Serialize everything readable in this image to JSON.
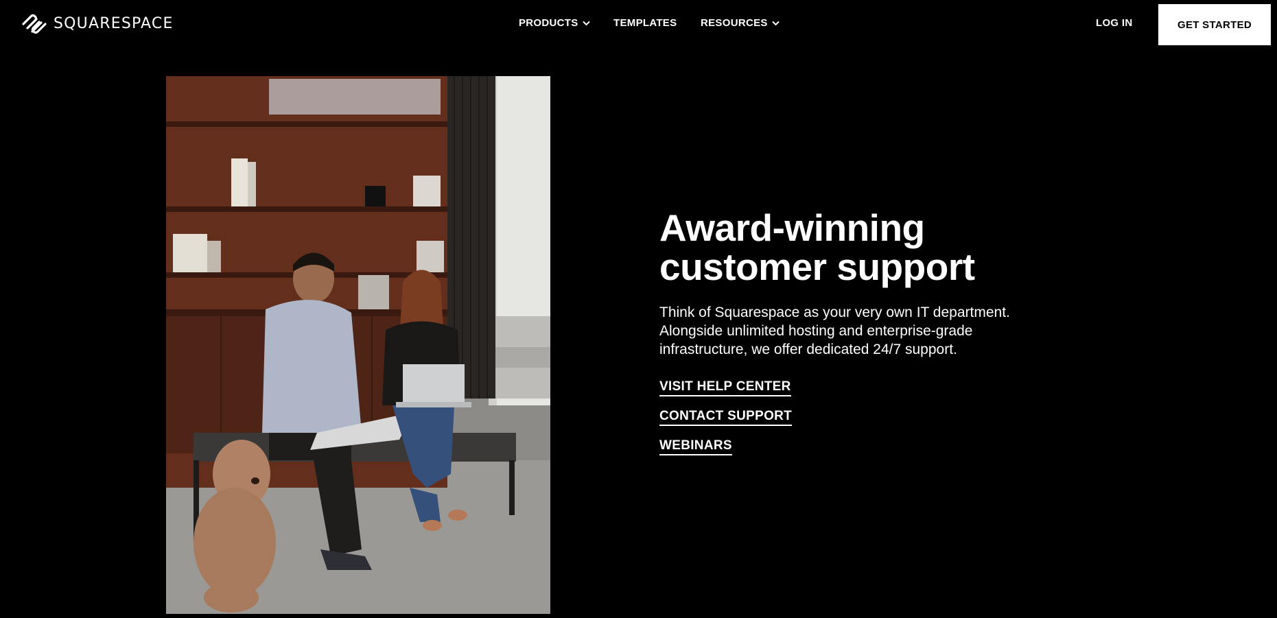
{
  "brand": {
    "name": "SQUARESPACE",
    "logo_icon": "squarespace-logo-icon"
  },
  "nav": {
    "products": "PRODUCTS",
    "templates": "TEMPLATES",
    "resources": "RESOURCES",
    "dropdown_icon": "chevron-down-icon"
  },
  "header_actions": {
    "login": "LOG IN",
    "get_started": "GET STARTED"
  },
  "hero": {
    "headline_line1": "Award-winning",
    "headline_line2": "customer support",
    "body": "Think of Squarespace as your very own IT department. Alongside unlimited hosting and enterprise-grade infrastructure, we offer dedicated 24/7 support.",
    "links": [
      "VISIT HELP CENTER",
      "CONTACT SUPPORT",
      "WEBINARS"
    ]
  },
  "colors": {
    "background": "#000000",
    "text": "#ffffff",
    "cta_background": "#ffffff",
    "cta_text": "#000000"
  }
}
